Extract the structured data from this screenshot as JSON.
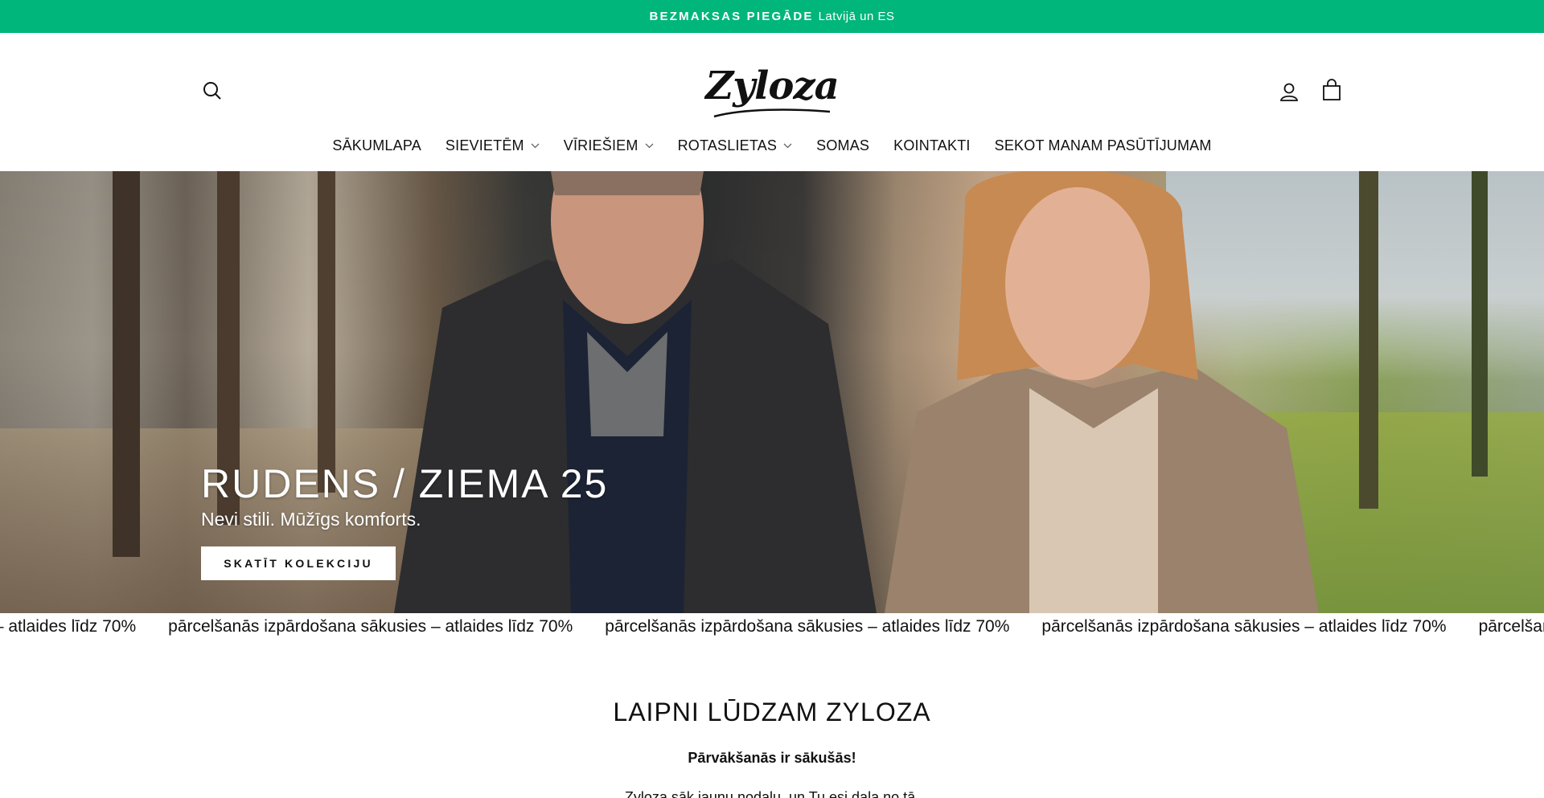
{
  "announcement": {
    "bold": "BEZMAKSAS PIEGĀDE",
    "text": "Latvijā un ES",
    "background": "#00b67a"
  },
  "header": {
    "logo": "Zyloza",
    "icons": [
      "search-icon",
      "user-icon",
      "bag-icon"
    ]
  },
  "nav": {
    "items": [
      {
        "label": "SĀKUMLAPA",
        "dropdown": false
      },
      {
        "label": "SIEVIETĒM",
        "dropdown": true
      },
      {
        "label": "VĪRIEŠIEM",
        "dropdown": true
      },
      {
        "label": "ROTASLIETAS",
        "dropdown": true
      },
      {
        "label": "SOMAS",
        "dropdown": false
      },
      {
        "label": "KOINTAKTI",
        "dropdown": false
      },
      {
        "label": "SEKOT MANAM PASŪTĪJUMAM",
        "dropdown": false
      }
    ]
  },
  "hero": {
    "title": "RUDENS / ZIEMA 25",
    "subtitle": "Nevi stili. Mūžīgs komforts.",
    "button": "SKATĪT KOLEKCIJU"
  },
  "marquee": {
    "items": [
      "pārcelšanās izpārdošana sākusies – atlaides līdz 70%",
      "pārcelšanās izpārdošana sākusies – atlaides līdz 70%",
      "pārcelšanās izpārdošana sākusies – atlaides līdz 70%",
      "pārcelšanās izpārdošana sākusies – atlaides līdz 70%",
      "pārcelšanās izpārdošana sākusies – atlaides līdz 70%"
    ]
  },
  "welcome": {
    "title": "LAIPNI LŪDZAM ZYLOZA",
    "subtitle": "Pārvākšanās ir sākušās!",
    "body": "Zyloza sāk jaunu nodaļu, un Tu esi daļa no tā."
  }
}
